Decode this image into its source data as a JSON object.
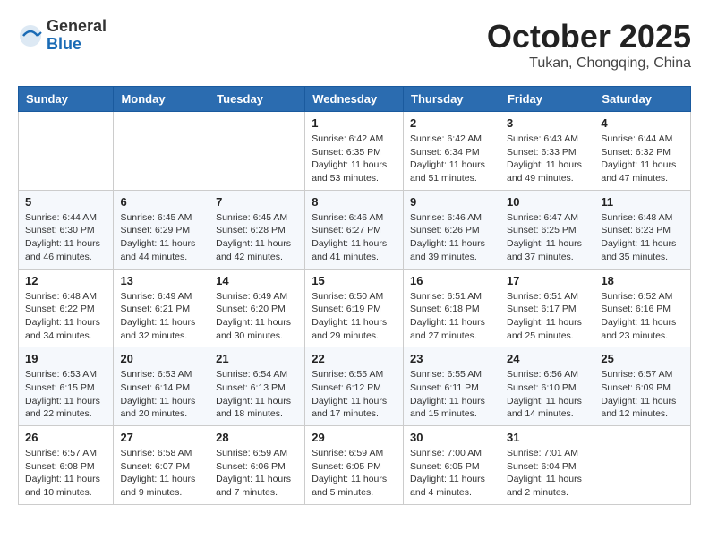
{
  "header": {
    "logo_general": "General",
    "logo_blue": "Blue",
    "month_title": "October 2025",
    "location": "Tukan, Chongqing, China"
  },
  "weekdays": [
    "Sunday",
    "Monday",
    "Tuesday",
    "Wednesday",
    "Thursday",
    "Friday",
    "Saturday"
  ],
  "weeks": [
    [
      {
        "day": "",
        "info": ""
      },
      {
        "day": "",
        "info": ""
      },
      {
        "day": "",
        "info": ""
      },
      {
        "day": "1",
        "info": "Sunrise: 6:42 AM\nSunset: 6:35 PM\nDaylight: 11 hours and 53 minutes."
      },
      {
        "day": "2",
        "info": "Sunrise: 6:42 AM\nSunset: 6:34 PM\nDaylight: 11 hours and 51 minutes."
      },
      {
        "day": "3",
        "info": "Sunrise: 6:43 AM\nSunset: 6:33 PM\nDaylight: 11 hours and 49 minutes."
      },
      {
        "day": "4",
        "info": "Sunrise: 6:44 AM\nSunset: 6:32 PM\nDaylight: 11 hours and 47 minutes."
      }
    ],
    [
      {
        "day": "5",
        "info": "Sunrise: 6:44 AM\nSunset: 6:30 PM\nDaylight: 11 hours and 46 minutes."
      },
      {
        "day": "6",
        "info": "Sunrise: 6:45 AM\nSunset: 6:29 PM\nDaylight: 11 hours and 44 minutes."
      },
      {
        "day": "7",
        "info": "Sunrise: 6:45 AM\nSunset: 6:28 PM\nDaylight: 11 hours and 42 minutes."
      },
      {
        "day": "8",
        "info": "Sunrise: 6:46 AM\nSunset: 6:27 PM\nDaylight: 11 hours and 41 minutes."
      },
      {
        "day": "9",
        "info": "Sunrise: 6:46 AM\nSunset: 6:26 PM\nDaylight: 11 hours and 39 minutes."
      },
      {
        "day": "10",
        "info": "Sunrise: 6:47 AM\nSunset: 6:25 PM\nDaylight: 11 hours and 37 minutes."
      },
      {
        "day": "11",
        "info": "Sunrise: 6:48 AM\nSunset: 6:23 PM\nDaylight: 11 hours and 35 minutes."
      }
    ],
    [
      {
        "day": "12",
        "info": "Sunrise: 6:48 AM\nSunset: 6:22 PM\nDaylight: 11 hours and 34 minutes."
      },
      {
        "day": "13",
        "info": "Sunrise: 6:49 AM\nSunset: 6:21 PM\nDaylight: 11 hours and 32 minutes."
      },
      {
        "day": "14",
        "info": "Sunrise: 6:49 AM\nSunset: 6:20 PM\nDaylight: 11 hours and 30 minutes."
      },
      {
        "day": "15",
        "info": "Sunrise: 6:50 AM\nSunset: 6:19 PM\nDaylight: 11 hours and 29 minutes."
      },
      {
        "day": "16",
        "info": "Sunrise: 6:51 AM\nSunset: 6:18 PM\nDaylight: 11 hours and 27 minutes."
      },
      {
        "day": "17",
        "info": "Sunrise: 6:51 AM\nSunset: 6:17 PM\nDaylight: 11 hours and 25 minutes."
      },
      {
        "day": "18",
        "info": "Sunrise: 6:52 AM\nSunset: 6:16 PM\nDaylight: 11 hours and 23 minutes."
      }
    ],
    [
      {
        "day": "19",
        "info": "Sunrise: 6:53 AM\nSunset: 6:15 PM\nDaylight: 11 hours and 22 minutes."
      },
      {
        "day": "20",
        "info": "Sunrise: 6:53 AM\nSunset: 6:14 PM\nDaylight: 11 hours and 20 minutes."
      },
      {
        "day": "21",
        "info": "Sunrise: 6:54 AM\nSunset: 6:13 PM\nDaylight: 11 hours and 18 minutes."
      },
      {
        "day": "22",
        "info": "Sunrise: 6:55 AM\nSunset: 6:12 PM\nDaylight: 11 hours and 17 minutes."
      },
      {
        "day": "23",
        "info": "Sunrise: 6:55 AM\nSunset: 6:11 PM\nDaylight: 11 hours and 15 minutes."
      },
      {
        "day": "24",
        "info": "Sunrise: 6:56 AM\nSunset: 6:10 PM\nDaylight: 11 hours and 14 minutes."
      },
      {
        "day": "25",
        "info": "Sunrise: 6:57 AM\nSunset: 6:09 PM\nDaylight: 11 hours and 12 minutes."
      }
    ],
    [
      {
        "day": "26",
        "info": "Sunrise: 6:57 AM\nSunset: 6:08 PM\nDaylight: 11 hours and 10 minutes."
      },
      {
        "day": "27",
        "info": "Sunrise: 6:58 AM\nSunset: 6:07 PM\nDaylight: 11 hours and 9 minutes."
      },
      {
        "day": "28",
        "info": "Sunrise: 6:59 AM\nSunset: 6:06 PM\nDaylight: 11 hours and 7 minutes."
      },
      {
        "day": "29",
        "info": "Sunrise: 6:59 AM\nSunset: 6:05 PM\nDaylight: 11 hours and 5 minutes."
      },
      {
        "day": "30",
        "info": "Sunrise: 7:00 AM\nSunset: 6:05 PM\nDaylight: 11 hours and 4 minutes."
      },
      {
        "day": "31",
        "info": "Sunrise: 7:01 AM\nSunset: 6:04 PM\nDaylight: 11 hours and 2 minutes."
      },
      {
        "day": "",
        "info": ""
      }
    ]
  ]
}
